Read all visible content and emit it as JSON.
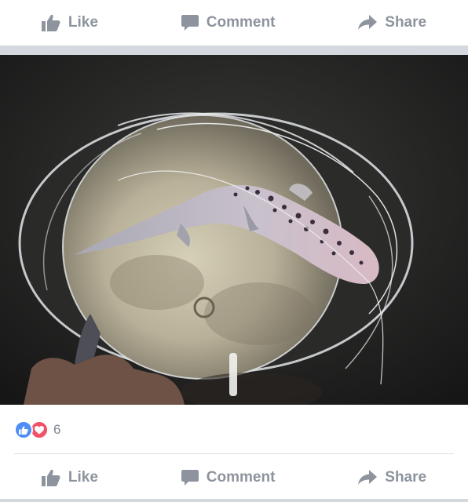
{
  "top_actions": {
    "like_label": "Like",
    "comment_label": "Comment",
    "share_label": "Share"
  },
  "post": {
    "photo_icon": "photo",
    "reaction_icons": [
      "like-icon",
      "love-icon"
    ],
    "reaction_count": "6"
  },
  "bottom_actions": {
    "like_label": "Like",
    "comment_label": "Comment",
    "share_label": "Share"
  },
  "colors": {
    "action_text": "#8d949e",
    "like_reaction": "#4f8ef7",
    "love_reaction": "#f25268",
    "divider": "#d5d8de"
  }
}
